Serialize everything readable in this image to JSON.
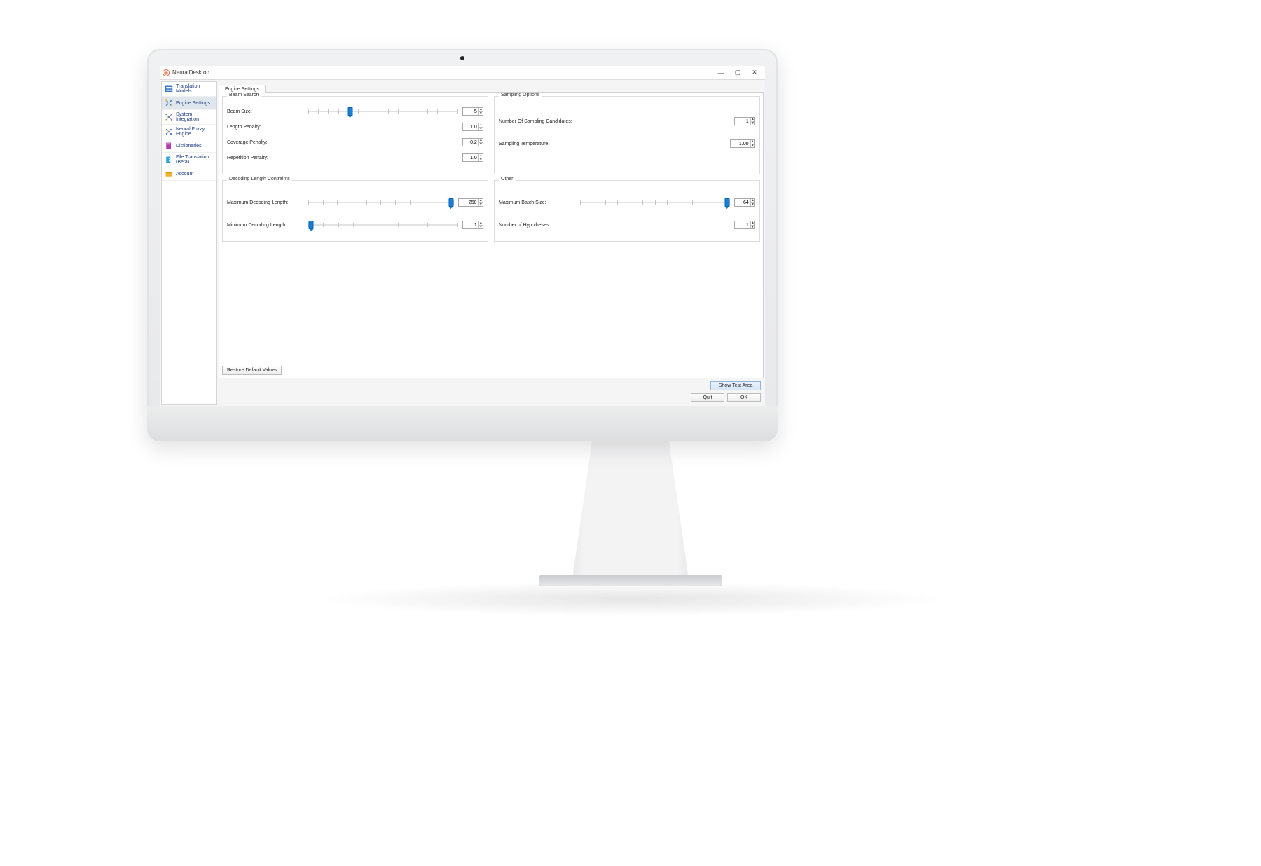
{
  "window": {
    "title": "NeuralDesktop"
  },
  "sidebar": {
    "items": [
      {
        "label": "Translation Models"
      },
      {
        "label": "Engine Settings"
      },
      {
        "label": "System Integration"
      },
      {
        "label": "Neural Fuzzy Engine"
      },
      {
        "label": "Dictionaries"
      },
      {
        "label": "File Translation (Beta)"
      },
      {
        "label": "Account"
      }
    ]
  },
  "tab": {
    "label": "Engine Settings"
  },
  "groups": {
    "beam_search": {
      "title": "Beam Search",
      "beam_size_label": "Beam Size:",
      "beam_size_value": "5",
      "length_penalty_label": "Length Penalty:",
      "length_penalty_value": "1.0",
      "coverage_penalty_label": "Coverage Penalty:",
      "coverage_penalty_value": "0.2",
      "repetition_penalty_label": "Repetition Penalty:",
      "repetition_penalty_value": "1.0"
    },
    "sampling": {
      "title": "Sampling Options",
      "candidates_label": "Number Of Sampling Candidates:",
      "candidates_value": "1",
      "temperature_label": "Sampling Temperature:",
      "temperature_value": "1.00"
    },
    "decoding": {
      "title": "Decoding Length Contraints",
      "max_label": "Maximum Decoding Length:",
      "max_value": "250",
      "min_label": "Minimum Decoding Length:",
      "min_value": "1"
    },
    "other": {
      "title": "Other",
      "batch_label": "Maximum Batch Size:",
      "batch_value": "64",
      "hyp_label": "Number of Hypotheses:",
      "hyp_value": "1"
    }
  },
  "buttons": {
    "restore": "Restore Default Values",
    "show_test": "Show Test Area",
    "quit": "Quit",
    "ok": "OK"
  }
}
